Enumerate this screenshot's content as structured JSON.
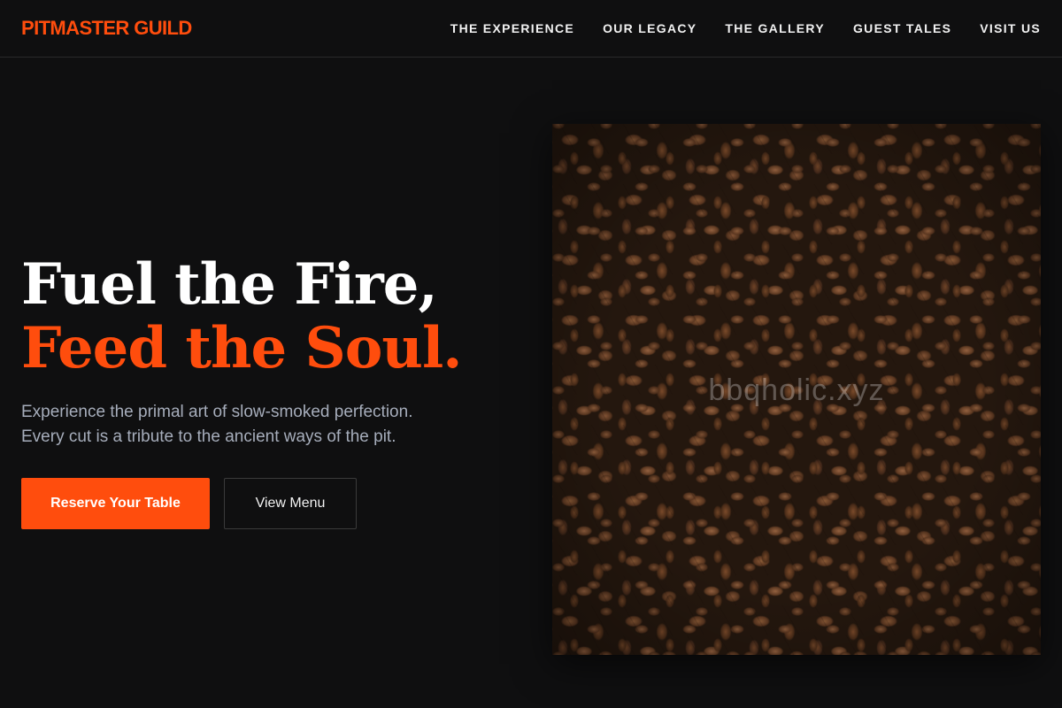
{
  "brand": {
    "name": "PITMASTER GUILD",
    "color": "#ff4d0d"
  },
  "nav": {
    "items": [
      {
        "label": "THE EXPERIENCE"
      },
      {
        "label": "OUR LEGACY"
      },
      {
        "label": "THE GALLERY"
      },
      {
        "label": "GUEST TALES"
      },
      {
        "label": "VISIT US"
      }
    ]
  },
  "hero": {
    "headline_line1": "Fuel the Fire,",
    "headline_line2": "Feed the Soul.",
    "subtitle_line1": "Experience the primal art of slow-smoked perfection.",
    "subtitle_line2": "Every cut is a tribute to the ancient ways of the pit.",
    "primary_cta": "Reserve Your Table",
    "secondary_cta": "View Menu",
    "image": {
      "subject": "roasted coffee beans",
      "watermark": "bbqholic.xyz"
    }
  },
  "colors": {
    "accent": "#ff4d0d",
    "background": "#0f0f10",
    "text": "#ffffff",
    "muted_text": "#a6adbb"
  }
}
